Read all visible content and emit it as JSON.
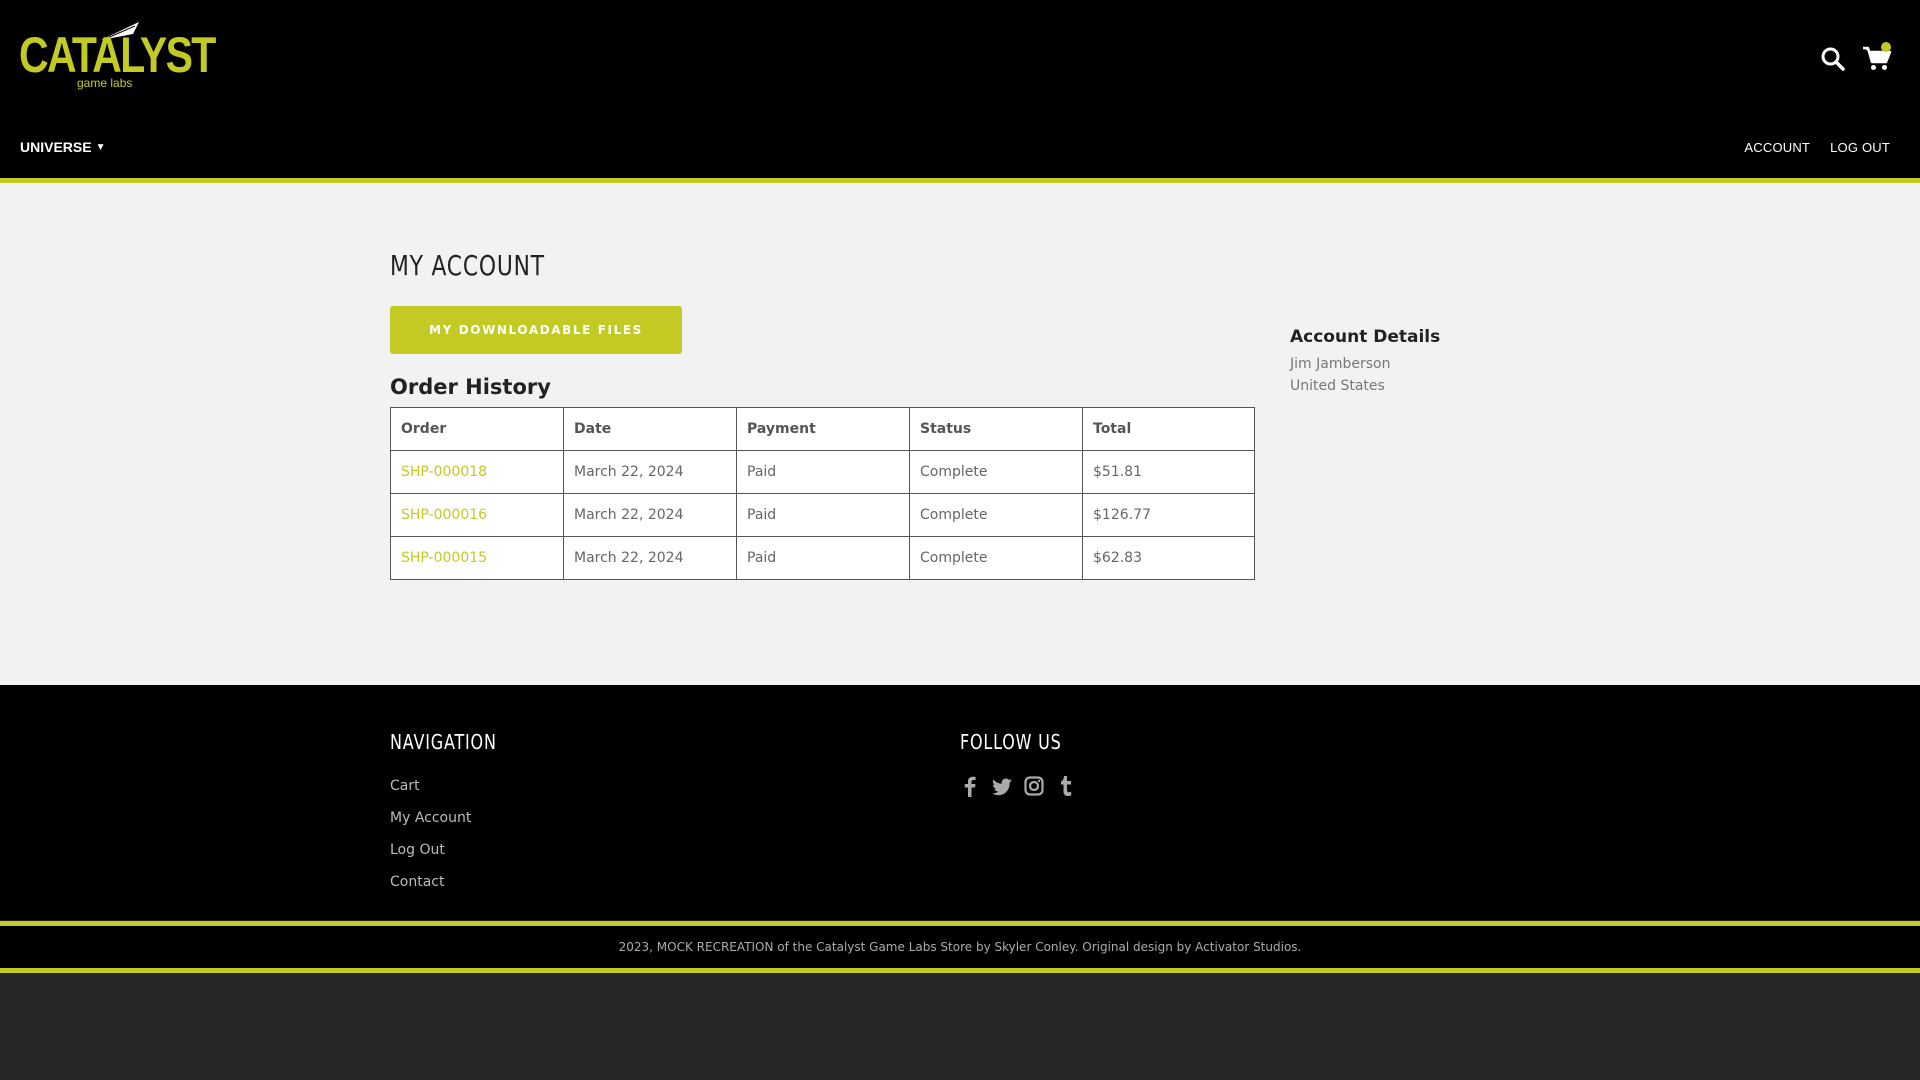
{
  "header": {
    "logo": {
      "main": "CATALYST",
      "sub": "game labs"
    },
    "nav_universe": "UNIVERSE",
    "topnav": {
      "account": "ACCOUNT",
      "logout": "LOG OUT"
    },
    "icons": {
      "search": "search-icon",
      "cart": "cart-icon",
      "cart_badge": "cart-badge-dot"
    }
  },
  "main": {
    "title": "MY ACCOUNT",
    "downloads_button": "MY DOWNLOADABLE FILES",
    "order_history_title": "Order History",
    "orders": {
      "columns": [
        "Order",
        "Date",
        "Payment",
        "Status",
        "Total"
      ],
      "rows": [
        {
          "order": "SHP-000018",
          "date": "March 22, 2024",
          "payment": "Paid",
          "status": "Complete",
          "total": "$51.81"
        },
        {
          "order": "SHP-000016",
          "date": "March 22, 2024",
          "payment": "Paid",
          "status": "Complete",
          "total": "$126.77"
        },
        {
          "order": "SHP-000015",
          "date": "March 22, 2024",
          "payment": "Paid",
          "status": "Complete",
          "total": "$62.83"
        }
      ]
    },
    "account_details": {
      "title": "Account Details",
      "name": "Jim Jamberson",
      "country": "United States"
    }
  },
  "footer": {
    "nav_title": "NAVIGATION",
    "nav_links": [
      "Cart",
      "My Account",
      "Log Out",
      "Contact"
    ],
    "follow_title": "FOLLOW US",
    "social_icons": [
      "facebook-icon",
      "twitter-icon",
      "instagram-icon",
      "tumblr-icon"
    ],
    "copyright": "2023, MOCK RECREATION of the Catalyst Game Labs Store by Skyler Conley. Original design by Activator Studios."
  },
  "colors": {
    "accent": "#c3ca24",
    "header_bg": "#000000",
    "main_bg": "#f2f2f2",
    "page_bottom": "#262626"
  }
}
